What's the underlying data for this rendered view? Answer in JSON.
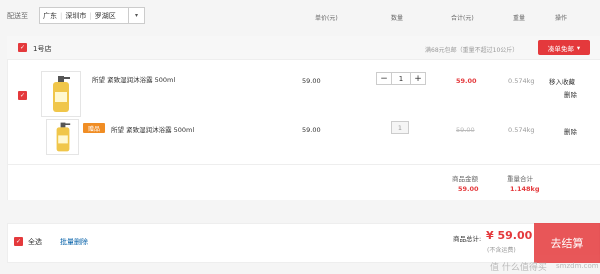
{
  "header": {
    "ship_to_label": "配送至",
    "address": [
      "广东",
      "深圳市",
      "罗湖区"
    ],
    "cols": {
      "price": "单价(元)",
      "qty": "数量",
      "subtotal": "合计(元)",
      "weight": "重量",
      "ops": "操作"
    }
  },
  "shop": {
    "name": "1号店",
    "shipping_note": "满68元包邮（重量不超过10公斤）",
    "coupon_label": "凑单免邮"
  },
  "items": [
    {
      "title": "所望 紧致湿润沐浴露 500ml",
      "unit_price": "59.00",
      "quantity": "1",
      "subtotal": "59.00",
      "weight": "0.574kg",
      "op_fav": "移入收藏",
      "op_delete": "删除"
    },
    {
      "gift_tag": "赠品",
      "title": "所望 紧致湿润沐浴露 500ml",
      "unit_price": "59.00",
      "quantity": "1",
      "subtotal": "59.00",
      "weight": "0.574kg",
      "op_delete": "删除"
    }
  ],
  "summary": {
    "amount_label": "商品金额",
    "amount": "59.00",
    "weight_label": "重量合计",
    "weight": "1.148kg"
  },
  "footer": {
    "select_all": "全选",
    "batch_delete": "批量删除",
    "total_label": "商品总计:",
    "total": "¥ 59.00",
    "shipping_note": "(不含运费)",
    "checkout": "去结算"
  },
  "watermark": {
    "text": "值 什么值得买",
    "sub": "smzdm.com"
  },
  "colors": {
    "accent": "#e4393c",
    "gift": "#f08d24"
  }
}
